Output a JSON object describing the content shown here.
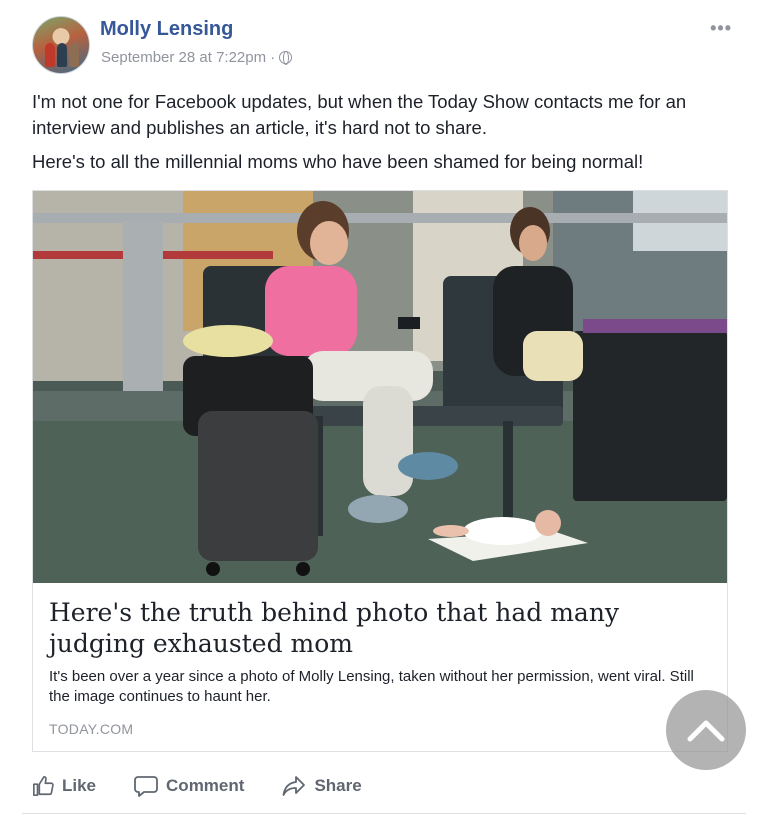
{
  "post": {
    "author": "Molly Lensing",
    "timestamp": "September 28 at 7:22pm · ",
    "privacy_icon": "globe-icon",
    "more_icon": "ellipsis-icon",
    "more_label": "•••",
    "paragraphs": [
      "I'm not one for Facebook updates, but when the Today Show contacts me for an interview and publishes an article, it's hard not to share.",
      "Here's to all the millennial moms who have been shamed for being normal!"
    ]
  },
  "link_card": {
    "title": "Here's the truth behind photo that had many judging exhausted mom",
    "description": "It's been over a year since a photo of Molly Lensing, taken without her permission, went viral. Still the image continues to haunt her.",
    "domain": "TODAY.COM"
  },
  "actions": {
    "like": "Like",
    "comment": "Comment",
    "share": "Share"
  },
  "scroll_top_icon": "chevron-up-icon",
  "colors": {
    "author": "#365899",
    "meta": "#90949c",
    "action": "#606770"
  }
}
